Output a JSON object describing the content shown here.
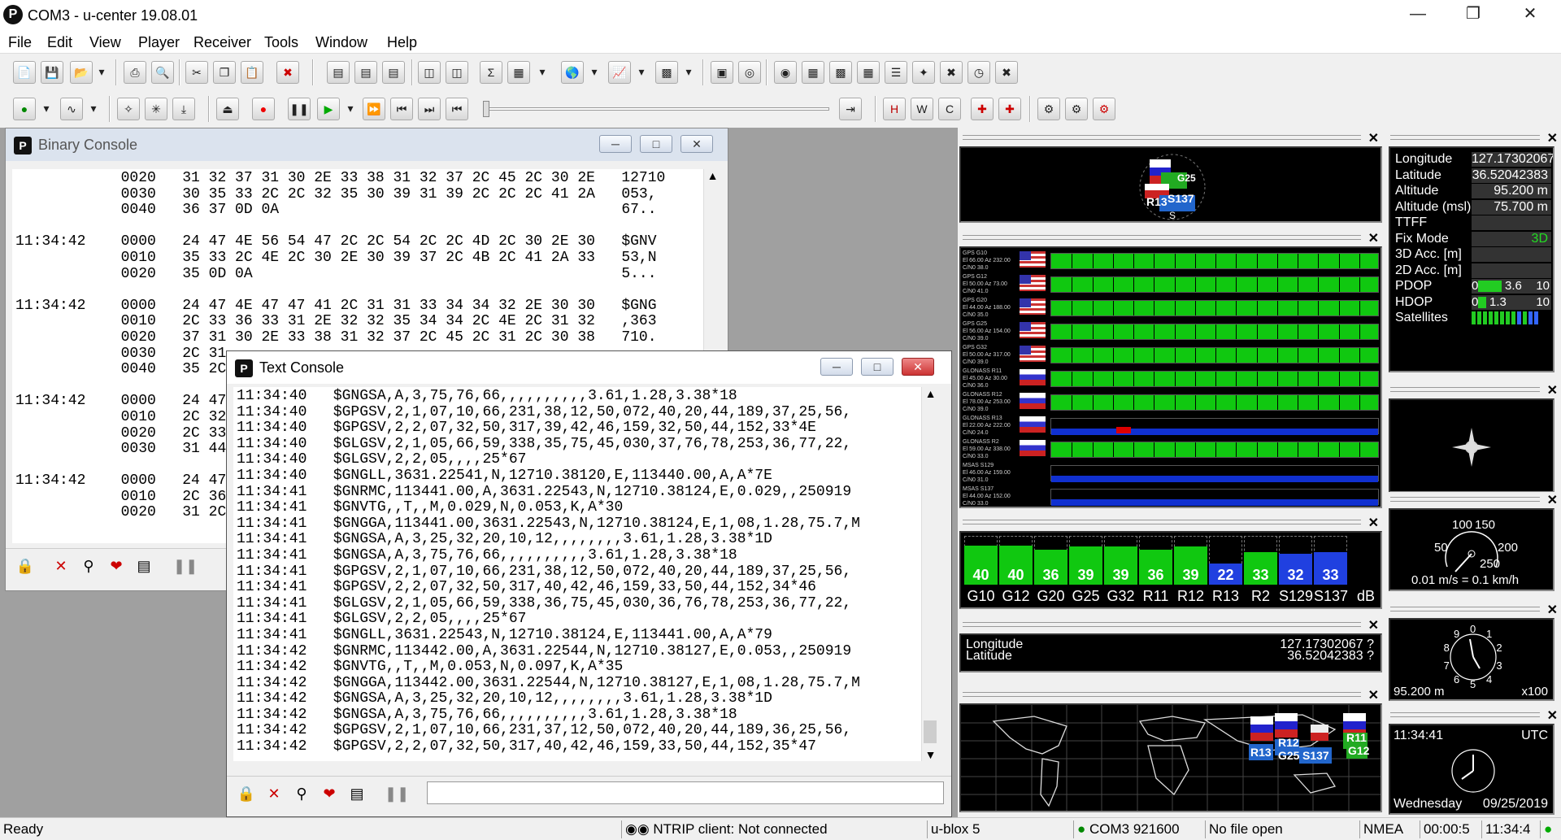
{
  "app": {
    "title": "COM3 - u-center 19.08.01",
    "icon": "P"
  },
  "menu": [
    "File",
    "Edit",
    "View",
    "Player",
    "Receiver",
    "Tools",
    "Window",
    "Help"
  ],
  "binary_console": {
    "title": "Binary Console",
    "lines": [
      "            0020   31 32 37 31 30 2E 33 38 31 32 37 2C 45 2C 30 2E   12710",
      "            0030   30 35 33 2C 2C 32 35 30 39 31 39 2C 2C 2C 41 2A   053,",
      "            0040   36 37 0D 0A                                       67..",
      "",
      "11:34:42    0000   24 47 4E 56 54 47 2C 2C 54 2C 2C 4D 2C 30 2E 30   $GNV",
      "            0010   35 33 2C 4E 2C 30 2E 30 39 37 2C 4B 2C 41 2A 33   53,N",
      "            0020   35 0D 0A                                          5...",
      "",
      "11:34:42    0000   24 47 4E 47 47 41 2C 31 31 33 34 34 32 2E 30 30   $GNG",
      "            0010   2C 33 36 33 31 2E 32 32 35 34 34 2C 4E 2C 31 32   ,363",
      "            0020   37 31 30 2E 33 38 31 32 37 2C 45 2C 31 2C 30 38   710.",
      "            0030   2C 31",
      "            0040   35 2C",
      "",
      "11:34:42    0000   24 47",
      "            0010   2C 32",
      "            0020   2C 33",
      "            0030   31 44",
      "",
      "11:34:42    0000   24 47",
      "            0010   2C 36",
      "            0020   31 2C"
    ]
  },
  "text_console": {
    "title": "Text Console",
    "lines": [
      "11:34:40   $GNGSA,A,3,75,76,66,,,,,,,,,,3.61,1.28,3.38*18",
      "11:34:40   $GPGSV,2,1,07,10,66,231,38,12,50,072,40,20,44,189,37,25,56,",
      "11:34:40   $GPGSV,2,2,07,32,50,317,39,42,46,159,32,50,44,152,33*4E",
      "11:34:40   $GLGSV,2,1,05,66,59,338,35,75,45,030,37,76,78,253,36,77,22,",
      "11:34:40   $GLGSV,2,2,05,,,,25*67",
      "11:34:40   $GNGLL,3631.22541,N,12710.38120,E,113440.00,A,A*7E",
      "11:34:41   $GNRMC,113441.00,A,3631.22543,N,12710.38124,E,0.029,,250919",
      "11:34:41   $GNVTG,,T,,M,0.029,N,0.053,K,A*30",
      "11:34:41   $GNGGA,113441.00,3631.22543,N,12710.38124,E,1,08,1.28,75.7,M",
      "11:34:41   $GNGSA,A,3,25,32,20,10,12,,,,,,,,3.61,1.28,3.38*1D",
      "11:34:41   $GNGSA,A,3,75,76,66,,,,,,,,,,3.61,1.28,3.38*18",
      "11:34:41   $GPGSV,2,1,07,10,66,231,38,12,50,072,40,20,44,189,37,25,56,",
      "11:34:41   $GPGSV,2,2,07,32,50,317,40,42,46,159,33,50,44,152,34*46",
      "11:34:41   $GLGSV,2,1,05,66,59,338,36,75,45,030,36,76,78,253,36,77,22,",
      "11:34:41   $GLGSV,2,2,05,,,,25*67",
      "11:34:41   $GNGLL,3631.22543,N,12710.38124,E,113441.00,A,A*79",
      "11:34:42   $GNRMC,113442.00,A,3631.22544,N,12710.38127,E,0.053,,250919",
      "11:34:42   $GNVTG,,T,,M,0.053,N,0.097,K,A*35",
      "11:34:42   $GNGGA,113442.00,3631.22544,N,12710.38127,E,1,08,1.28,75.7,M",
      "11:34:42   $GNGSA,A,3,25,32,20,10,12,,,,,,,,3.61,1.28,3.38*1D",
      "11:34:42   $GNGSA,A,3,75,76,66,,,,,,,,,,3.61,1.28,3.38*18",
      "11:34:42   $GPGSV,2,1,07,10,66,231,37,12,50,072,40,20,44,189,36,25,56,",
      "11:34:42   $GPGSV,2,2,07,32,50,317,40,42,46,159,33,50,44,152,35*47"
    ]
  },
  "sky": {
    "labels": [
      "R13",
      "S137",
      "G25",
      "S"
    ]
  },
  "signal_list": {
    "rows": [
      {
        "sat": "GPS G10",
        "l1": "El 66.00 Az 232.00",
        "l2": "C/N0 38.0",
        "flag": "us",
        "fill": 1.0,
        "color": "#10c810"
      },
      {
        "sat": "GPS G12",
        "l1": "El 50.00 Az 73.00",
        "l2": "C/N0 41.0",
        "flag": "us",
        "fill": 1.0,
        "color": "#10c810"
      },
      {
        "sat": "GPS G20",
        "l1": "El 44.00 Az 188.00",
        "l2": "C/N0 35.0",
        "flag": "us",
        "fill": 1.0,
        "color": "#10c810"
      },
      {
        "sat": "GPS G25",
        "l1": "El 56.00 Az 154.00",
        "l2": "C/N0 39.0",
        "flag": "us",
        "fill": 1.0,
        "color": "#10c810"
      },
      {
        "sat": "GPS G32",
        "l1": "El 50.00 Az 317.00",
        "l2": "C/N0 39.0",
        "flag": "us",
        "fill": 1.0,
        "color": "#10c810"
      },
      {
        "sat": "GLONASS R11",
        "l1": "El 45.00 Az 30.00",
        "l2": "C/N0 36.0",
        "flag": "ru",
        "fill": 1.0,
        "color": "#10c810"
      },
      {
        "sat": "GLONASS R12",
        "l1": "El 78.00 Az 253.00",
        "l2": "C/N0 39.0",
        "flag": "ru",
        "fill": 1.0,
        "color": "#10c810"
      },
      {
        "sat": "GLONASS R13",
        "l1": "El 22.00 Az 222.00",
        "l2": "C/N0 24.0",
        "flag": "ru",
        "fill": 0.0,
        "color": "#1030d0"
      },
      {
        "sat": "GLONASS R2",
        "l1": "El 59.00 Az 338.00",
        "l2": "C/N0 33.0",
        "flag": "ru",
        "fill": 1.0,
        "color": "#10c810"
      },
      {
        "sat": "MSAS S129",
        "l1": "El 46.00 Az 159.00",
        "l2": "C/N0 31.0",
        "flag": "",
        "fill": 0.0,
        "color": "#1030d0"
      },
      {
        "sat": "MSAS S137",
        "l1": "El 44.00 Az 152.00",
        "l2": "C/N0 33.0",
        "flag": "",
        "fill": 0.0,
        "color": "#1030d0"
      }
    ]
  },
  "snr_chart": {
    "bars": [
      {
        "label": "G10",
        "value": 40,
        "color": "#10c810"
      },
      {
        "label": "G12",
        "value": 40,
        "color": "#10c810"
      },
      {
        "label": "G20",
        "value": 36,
        "color": "#10c810"
      },
      {
        "label": "G25",
        "value": 39,
        "color": "#10c810"
      },
      {
        "label": "G32",
        "value": 39,
        "color": "#10c810"
      },
      {
        "label": "R11",
        "value": 36,
        "color": "#10c810"
      },
      {
        "label": "R12",
        "value": 39,
        "color": "#10c810"
      },
      {
        "label": "R13",
        "value": 22,
        "color": "#2040e0"
      },
      {
        "label": "R2",
        "value": 33,
        "color": "#10c810"
      },
      {
        "label": "S129",
        "value": 32,
        "color": "#2040e0"
      },
      {
        "label": "S137",
        "value": 33,
        "color": "#2040e0"
      }
    ],
    "unit": "dB"
  },
  "position_bar": {
    "lon_label": "Longitude",
    "lat_label": "Latitude",
    "lon": "127.17302067 ?",
    "lat": "36.52042383 ?"
  },
  "world_map": {
    "labels": [
      "R13",
      "G25",
      "S137",
      "R12",
      "R11",
      "G12"
    ]
  },
  "data_view": {
    "rows": [
      {
        "label": "Longitude",
        "value": "127.17302067 ?"
      },
      {
        "label": "Latitude",
        "value": "36.52042383 ?"
      },
      {
        "label": "Altitude",
        "value": "95.200 m"
      },
      {
        "label": "Altitude (msl)",
        "value": "75.700 m"
      },
      {
        "label": "TTFF",
        "value": ""
      },
      {
        "label": "Fix Mode",
        "value": "3D"
      },
      {
        "label": "3D Acc. [m]",
        "value": ""
      },
      {
        "label": "2D Acc. [m]",
        "value": ""
      }
    ],
    "pdop_label": "PDOP",
    "pdop_min": "0",
    "pdop_value": "3.6",
    "pdop_max": "10",
    "pdop_fraction": 0.36,
    "hdop_label": "HDOP",
    "hdop_min": "0",
    "hdop_value": "1.3",
    "hdop_max": "10",
    "hdop_fraction": 0.13,
    "sat_label": "Satellites"
  },
  "speed_gauge": {
    "top": "100",
    "top2": "150",
    "left": "50",
    "right": "200",
    "bottom": "250",
    "unit": "0.01 m/s = 0.1 km/h"
  },
  "altimeter": {
    "value": "95.200 m",
    "scale": "x100",
    "digits": [
      "0",
      "1",
      "2",
      "3",
      "4",
      "5",
      "6",
      "7",
      "8",
      "9"
    ]
  },
  "clock": {
    "time": "11:34:41",
    "zone": "UTC",
    "day": "Wednesday",
    "date": "09/25/2019"
  },
  "status": {
    "ready": "Ready",
    "ntrip": "NTRIP client: Not connected",
    "receiver": "u-blox 5",
    "port": "COM3 921600",
    "file": "No file open",
    "protocol": "NMEA",
    "elapsed": "00:00:5",
    "time": "11:34:4"
  }
}
